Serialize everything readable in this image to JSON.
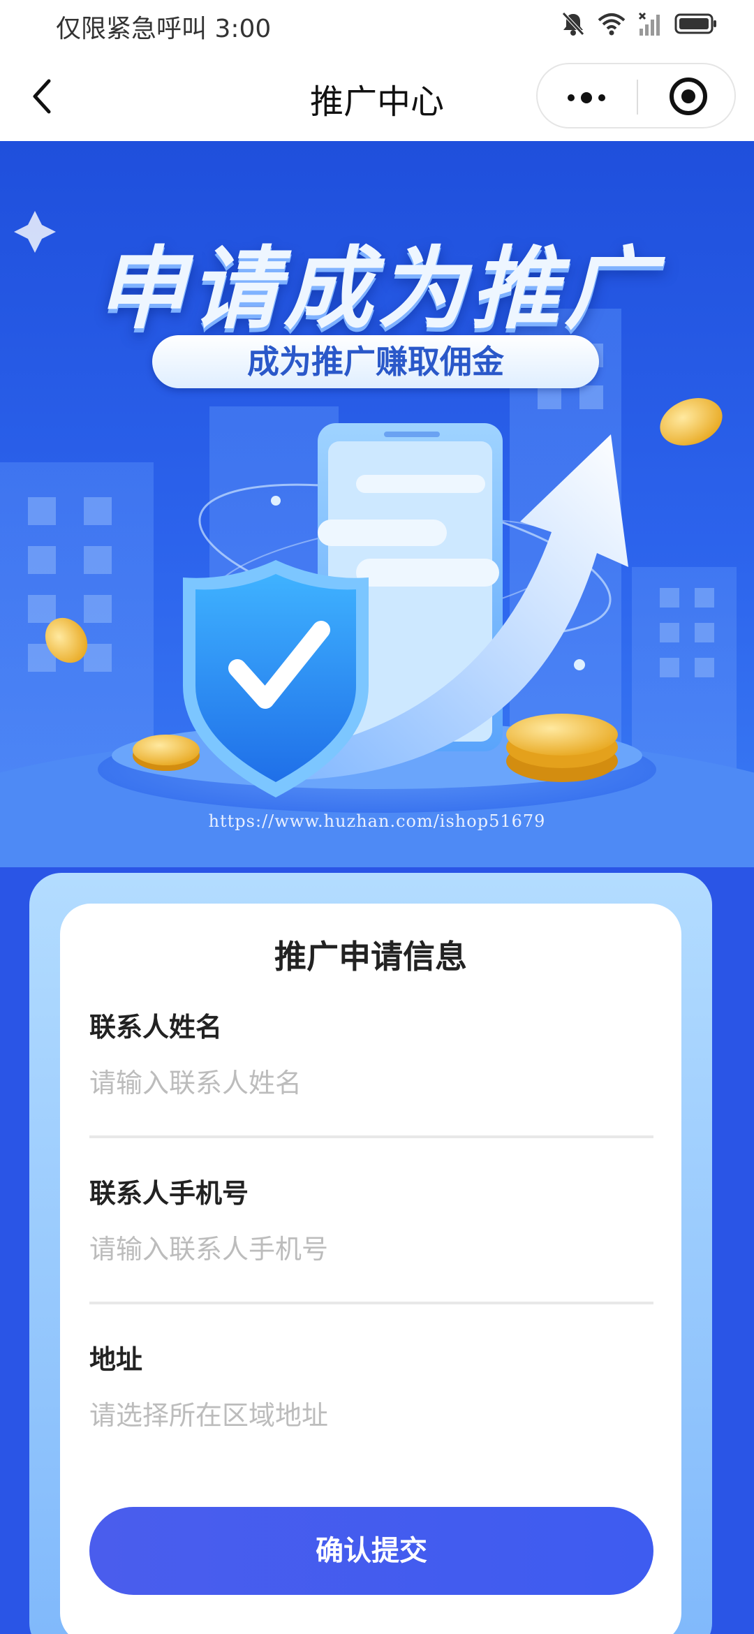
{
  "status_bar": {
    "carrier_text": "仅限紧急呼叫",
    "time": "3:00",
    "icons": [
      "mute-icon",
      "wifi-icon",
      "signal-icon",
      "battery-icon"
    ]
  },
  "navbar": {
    "title": "推广中心",
    "icons": [
      "back-icon",
      "more-icon",
      "target-icon"
    ]
  },
  "banner": {
    "title": "申请成为推广",
    "subtitle": "成为推广赚取佣金",
    "watermark": "https://www.huzhan.com/ishop51679"
  },
  "form": {
    "title": "推广申请信息",
    "fields": [
      {
        "label": "联系人姓名",
        "placeholder": "请输入联系人姓名",
        "value": ""
      },
      {
        "label": "联系人手机号",
        "placeholder": "请输入联系人手机号",
        "value": ""
      },
      {
        "label": "地址",
        "placeholder": "请选择所在区域地址",
        "value": ""
      }
    ],
    "submit_label": "确认提交"
  },
  "colors": {
    "banner_blue": "#2a55e6",
    "button_blue": "#4a5ded",
    "card_border": "#a8d3ff"
  }
}
